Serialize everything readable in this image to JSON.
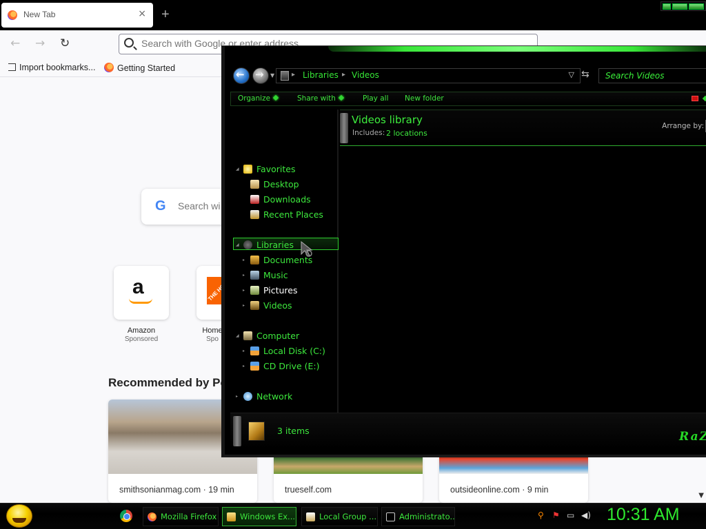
{
  "firefox": {
    "tab_title": "New Tab",
    "tab_close": "×",
    "new_tab_symbol": "+",
    "url_placeholder": "Search with Google or enter address",
    "nav": {
      "back": "←",
      "forward": "→",
      "reload": "↻"
    },
    "bookmarks": [
      {
        "label": "Import bookmarks...",
        "icon": "import-icon"
      },
      {
        "label": "Getting Started",
        "icon": "firefox-icon"
      }
    ],
    "google_search_placeholder": "Search wi",
    "google_logo": "G",
    "top_sites": [
      {
        "label": "Amazon",
        "sub": "Sponsored",
        "glyph": "a"
      },
      {
        "label": "Home",
        "sub": "Spo",
        "glyph": "THE HOME"
      }
    ],
    "recommended_heading": "Recommended by Po",
    "stories": [
      {
        "source": "smithsonianmag.com · 19 min"
      },
      {
        "source": "trueself.com"
      },
      {
        "source": "outsideonline.com · 9 min"
      }
    ]
  },
  "explorer": {
    "breadcrumb": [
      "Libraries",
      "Videos"
    ],
    "search_placeholder": "Search Videos",
    "commands": [
      "Organize",
      "Share with",
      "Play all",
      "New folder"
    ],
    "nav_tree": [
      {
        "label": "Favorites",
        "level": 0,
        "icon": "star-icon"
      },
      {
        "label": "Desktop",
        "level": 1,
        "icon": "desktop-icon"
      },
      {
        "label": "Downloads",
        "level": 1,
        "icon": "downloads-icon"
      },
      {
        "label": "Recent Places",
        "level": 1,
        "icon": "recent-places-icon"
      },
      {
        "label": "Libraries",
        "level": 0,
        "icon": "libraries-icon"
      },
      {
        "label": "Documents",
        "level": 1,
        "icon": "documents-icon"
      },
      {
        "label": "Music",
        "level": 1,
        "icon": "music-icon"
      },
      {
        "label": "Pictures",
        "level": 1,
        "icon": "pictures-icon",
        "selected": true
      },
      {
        "label": "Videos",
        "level": 1,
        "icon": "videos-icon"
      },
      {
        "label": "Computer",
        "level": 0,
        "icon": "computer-icon"
      },
      {
        "label": "Local Disk (C:)",
        "level": 1,
        "icon": "local-disk-icon"
      },
      {
        "label": "CD Drive (E:)",
        "level": 1,
        "icon": "cd-drive-icon"
      },
      {
        "label": "Network",
        "level": 0,
        "icon": "network-icon"
      }
    ],
    "library_title": "Videos library",
    "includes_label": "Includes:",
    "includes_locations": "2 locations",
    "arrange_by_label": "Arrange by:",
    "status_items": "3 items",
    "status_logo": "RaZ"
  },
  "taskbar": {
    "buttons": [
      {
        "label": "Mozilla Firefox",
        "icon": "firefox-icon",
        "active": false
      },
      {
        "label": "Windows Ex...",
        "icon": "folder-icon",
        "active": true
      },
      {
        "label": "Local Group ...",
        "icon": "policy-icon",
        "active": false
      },
      {
        "label": "Administrato...",
        "icon": "cmd-icon",
        "active": false
      }
    ],
    "clock": "10:31 AM"
  },
  "colors": {
    "accent_green": "#3de83d",
    "selection_border": "#2fcf2f"
  }
}
